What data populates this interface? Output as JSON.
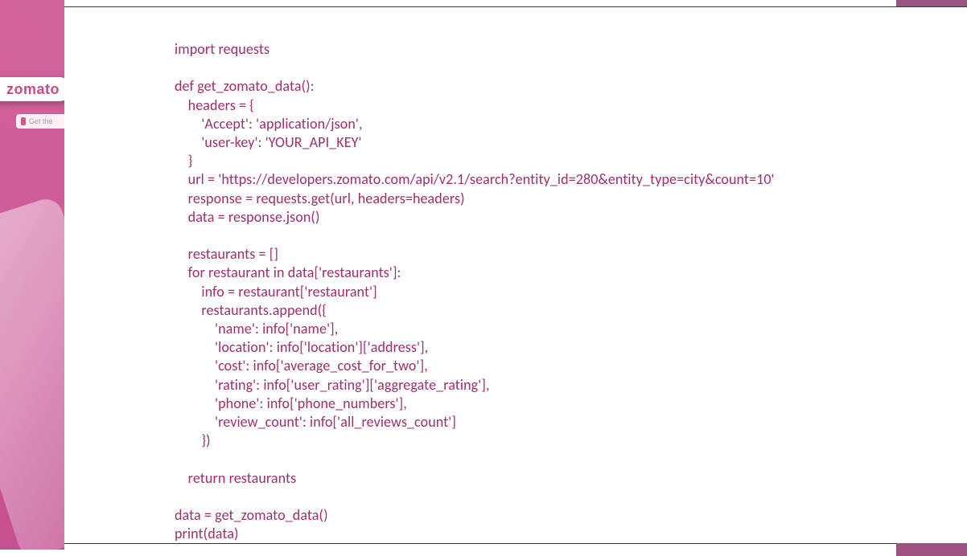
{
  "sidebar": {
    "brand_text": "zomato",
    "getthe_text": "Get the"
  },
  "code": {
    "text": "import requests\n\ndef get_zomato_data():\n    headers = {\n        'Accept': 'application/json',\n        'user-key': 'YOUR_API_KEY'\n    }\n    url = 'https://developers.zomato.com/api/v2.1/search?entity_id=280&entity_type=city&count=10'\n    response = requests.get(url, headers=headers)\n    data = response.json()\n\n    restaurants = []\n    for restaurant in data['restaurants']:\n        info = restaurant['restaurant']\n        restaurants.append({\n            'name': info['name'],\n            'location': info['location']['address'],\n            'cost': info['average_cost_for_two'],\n            'rating': info['user_rating']['aggregate_rating'],\n            'phone': info['phone_numbers'],\n            'review_count': info['all_reviews_count']\n        })\n\n    return restaurants\n\ndata = get_zomato_data()\nprint(data)"
  },
  "colors": {
    "code_color": "#9f2f6a",
    "accent": "#9c5382",
    "rule": "#2b3a4a"
  }
}
